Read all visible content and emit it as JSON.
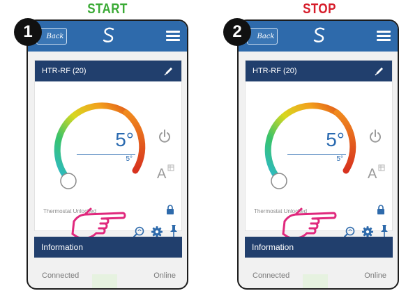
{
  "steps": [
    {
      "number": "1",
      "caption": "START",
      "caption_color": "#3aaa35",
      "app": {
        "back_label": "Back",
        "device_name": "HTR-RF (20)",
        "set_temperature": "5°",
        "current_temperature": "5°",
        "lock_status": "Thermostat Unlocked",
        "info_title": "Information",
        "connection_label": "Connected",
        "connection_value": "Online"
      }
    },
    {
      "number": "2",
      "caption": "STOP",
      "caption_color": "#d61c2a",
      "app": {
        "back_label": "Back",
        "device_name": "HTR-RF (20)",
        "set_temperature": "5°",
        "current_temperature": "5°",
        "lock_status": "Thermostat Unlocked",
        "info_title": "Information",
        "connection_label": "Connected",
        "connection_value": "Online"
      }
    }
  ],
  "icons": {
    "logo": "salus-logo-icon",
    "menu": "hamburger-menu-icon",
    "edit": "pencil-icon",
    "power": "power-icon",
    "auto_mode": "auto-mode-icon",
    "lock": "padlock-icon",
    "boost": "boost-search-icon",
    "settings": "gear-icon",
    "pin": "pushpin-icon",
    "pointer": "pointing-hand-icon"
  },
  "colors": {
    "topbar": "#2e6aab",
    "header_bar": "#213f6d",
    "accent_temperature": "#2a6ab0"
  }
}
